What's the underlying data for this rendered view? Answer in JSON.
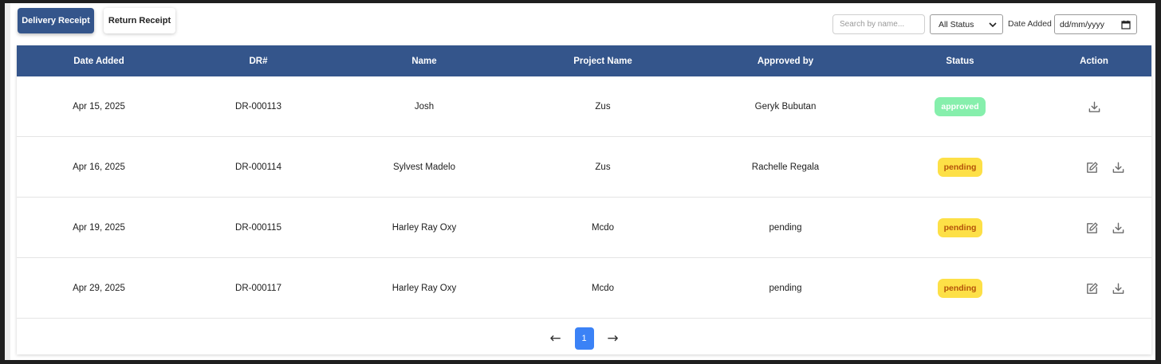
{
  "tabs": {
    "delivery_receipt": "Delivery Receipt",
    "return_receipt": "Return Receipt"
  },
  "filters": {
    "search_placeholder": "Search by name...",
    "status_selected": "All Status",
    "date_label": "Date Added",
    "date_placeholder": "dd/mm/yyyy"
  },
  "table": {
    "headers": [
      "Date Added",
      "DR#",
      "Name",
      "Project Name",
      "Approved by",
      "Status",
      "Action"
    ],
    "rows": [
      {
        "date": "Apr 15, 2025",
        "dr": "DR-000113",
        "name": "Josh",
        "project": "Zus",
        "approved_by": "Geryk Bubutan",
        "status": "approved",
        "actions": [
          "download"
        ]
      },
      {
        "date": "Apr 16, 2025",
        "dr": "DR-000114",
        "name": "Sylvest Madelo",
        "project": "Zus",
        "approved_by": "Rachelle Regala",
        "status": "pending",
        "actions": [
          "edit",
          "download"
        ]
      },
      {
        "date": "Apr 19, 2025",
        "dr": "DR-000115",
        "name": "Harley Ray Oxy",
        "project": "Mcdo",
        "approved_by": "pending",
        "status": "pending",
        "actions": [
          "edit",
          "download"
        ]
      },
      {
        "date": "Apr 29, 2025",
        "dr": "DR-000117",
        "name": "Harley Ray Oxy",
        "project": "Mcdo",
        "approved_by": "pending",
        "status": "pending",
        "actions": [
          "edit",
          "download"
        ]
      }
    ]
  },
  "pagination": {
    "prev": "←",
    "current": "1",
    "next": "→"
  },
  "icons": {
    "status_caret": "chevron-down-icon",
    "date_picker": "calendar-icon",
    "edit": "edit-icon",
    "download": "download-icon"
  },
  "colors": {
    "primary": "#34558b",
    "approved_badge": "#86efac",
    "pending_badge": "#fde047",
    "pending_text": "#b45309",
    "page_active": "#3b82f6"
  }
}
